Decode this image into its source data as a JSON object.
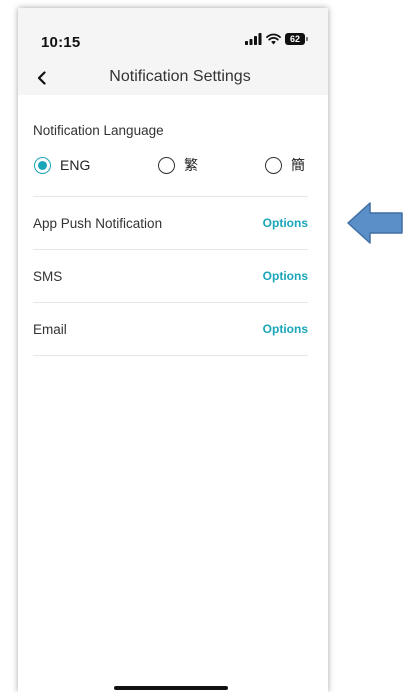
{
  "status_bar": {
    "time": "10:15",
    "battery_level": "62",
    "icons": [
      "signal-icon",
      "wifi-icon",
      "battery-icon"
    ]
  },
  "nav": {
    "back_icon": "chevron-left-icon",
    "title": "Notification Settings"
  },
  "language": {
    "label": "Notification Language",
    "options": [
      {
        "label": "ENG",
        "selected": true
      },
      {
        "label": "繁",
        "selected": false
      },
      {
        "label": "簡",
        "selected": false
      }
    ]
  },
  "settings": [
    {
      "label": "App Push Notification",
      "action": "Options"
    },
    {
      "label": "SMS",
      "action": "Options"
    },
    {
      "label": "Email",
      "action": "Options"
    }
  ],
  "annotation": {
    "icon": "left-arrow-icon",
    "color": "#5a8fc8"
  },
  "colors": {
    "accent": "#1aa6b8",
    "header_bg": "#f5f5f5",
    "divider": "#e6e6e6"
  }
}
